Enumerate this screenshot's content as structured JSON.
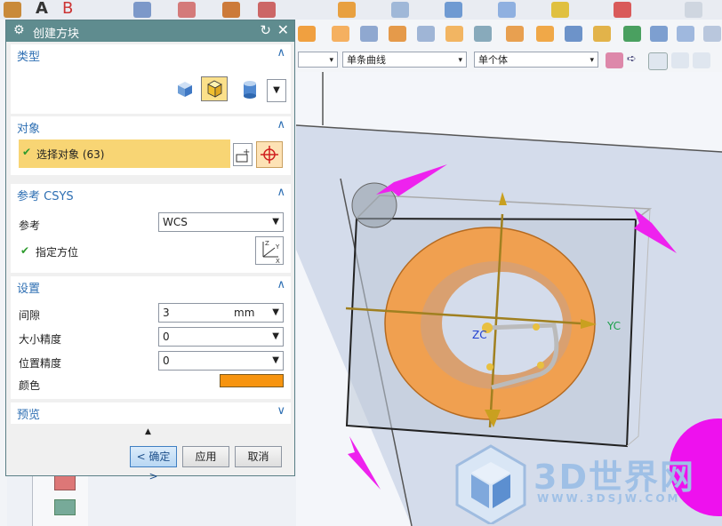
{
  "dialog": {
    "title": "创建方块",
    "sections": {
      "type": {
        "label": "类型",
        "chevron": "^"
      },
      "object": {
        "label": "对象",
        "chevron": "^",
        "select_label": "选择对象 (63)"
      },
      "csys": {
        "label": "参考 CSYS",
        "chevron": "^",
        "ref_label": "参考",
        "ref_value": "WCS",
        "orient_label": "指定方位"
      },
      "settings": {
        "label": "设置",
        "chevron": "^",
        "gap_label": "间隙",
        "gap_value": "3",
        "gap_unit": "mm",
        "size_precision_label": "大小精度",
        "size_precision_value": "0",
        "pos_precision_label": "位置精度",
        "pos_precision_value": "0",
        "color_label": "颜色",
        "color_value": "#f7940f"
      },
      "preview": {
        "label": "预览",
        "chevron": "v"
      }
    },
    "buttons": {
      "ok": "< 确定 >",
      "apply": "应用",
      "cancel": "取消"
    }
  },
  "toolbar": {
    "filter_curve": "单条曲线",
    "filter_body": "单个体"
  },
  "viewport": {
    "axis_x_label": "YC",
    "axis_z_label": "ZC"
  },
  "watermark": {
    "text": "3D世界网",
    "url": "WWW.3DSJW.COM"
  },
  "colors": {
    "title_bar": "#5f8c8f",
    "section_label": "#2e6fb3",
    "object_highlight": "#f8d574",
    "arrow": "#ee22ee",
    "ring": "#f0a050"
  }
}
